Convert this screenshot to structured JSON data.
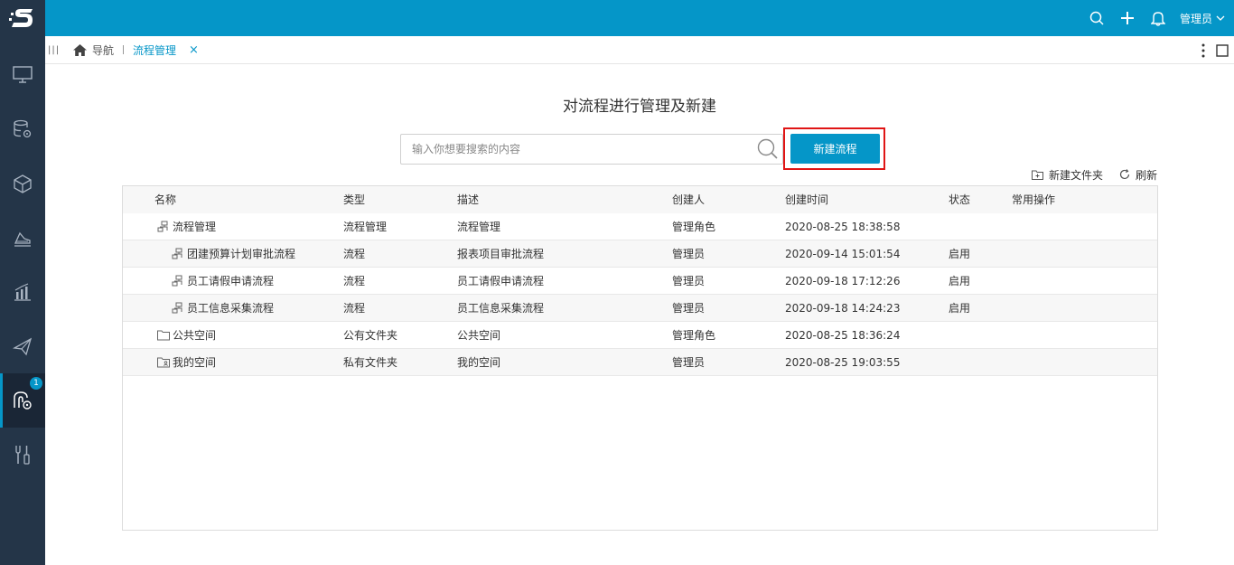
{
  "header": {
    "user_label": "管理员",
    "brand_color": "#0596c8",
    "sidebar_color": "#243548",
    "icons": [
      "search-icon",
      "plus-icon",
      "bell-icon",
      "chevron-down-icon"
    ]
  },
  "sidebar": {
    "items": [
      {
        "icon": "monitor-icon"
      },
      {
        "icon": "database-gear-icon"
      },
      {
        "icon": "cube-icon"
      },
      {
        "icon": "chart-area-icon"
      },
      {
        "icon": "bar-chart-icon"
      },
      {
        "icon": "send-icon"
      },
      {
        "icon": "workflow-gear-icon",
        "badge": "1",
        "active": true
      },
      {
        "icon": "tools-icon"
      }
    ]
  },
  "tabs": {
    "home_label": "导航",
    "active_label": "流程管理",
    "close_symbol": "×"
  },
  "main": {
    "title": "对流程进行管理及新建",
    "search_placeholder": "输入你想要搜索的内容",
    "new_flow_label": "新建流程",
    "new_folder_label": "新建文件夹",
    "refresh_label": "刷新"
  },
  "table": {
    "columns": [
      "名称",
      "类型",
      "描述",
      "创建人",
      "创建时间",
      "状态",
      "常用操作"
    ],
    "rows": [
      {
        "name": "流程管理",
        "type": "流程管理",
        "desc": "流程管理",
        "creator": "管理角色",
        "time": "2020-08-25 18:38:58",
        "status": "",
        "icon": "flow-folder-icon"
      },
      {
        "name": "团建预算计划审批流程",
        "type": "流程",
        "desc": "报表项目审批流程",
        "creator": "管理员",
        "time": "2020-09-14 15:01:54",
        "status": "启用",
        "icon": "flow-icon"
      },
      {
        "name": "员工请假申请流程",
        "type": "流程",
        "desc": "员工请假申请流程",
        "creator": "管理员",
        "time": "2020-09-18 17:12:26",
        "status": "启用",
        "icon": "flow-icon"
      },
      {
        "name": "员工信息采集流程",
        "type": "流程",
        "desc": "员工信息采集流程",
        "creator": "管理员",
        "time": "2020-09-18 14:24:23",
        "status": "启用",
        "icon": "flow-icon"
      },
      {
        "name": "公共空间",
        "type": "公有文件夹",
        "desc": "公共空间",
        "creator": "管理角色",
        "time": "2020-08-25 18:36:24",
        "status": "",
        "icon": "folder-icon"
      },
      {
        "name": "我的空间",
        "type": "私有文件夹",
        "desc": "我的空间",
        "creator": "管理员",
        "time": "2020-08-25 19:03:55",
        "status": "",
        "icon": "private-folder-icon"
      }
    ]
  }
}
